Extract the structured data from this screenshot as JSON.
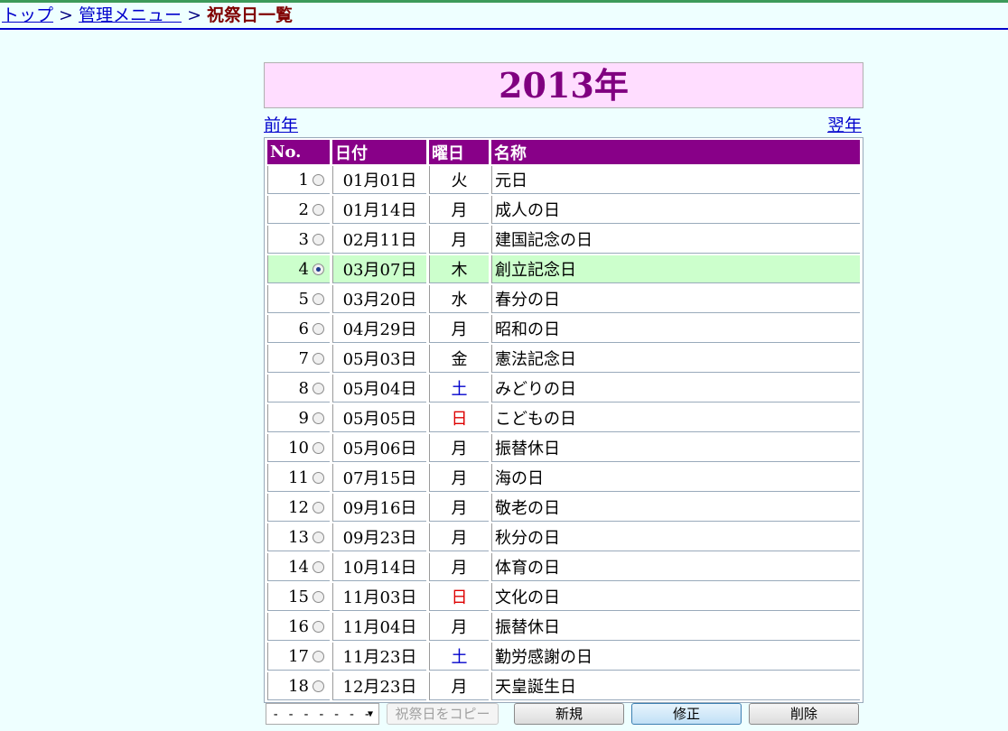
{
  "breadcrumb": {
    "top": "トップ",
    "sep1": " > ",
    "menu": "管理メニュー",
    "sep2": " > ",
    "current": "祝祭日一覧"
  },
  "year_title": "2013年",
  "nav": {
    "prev": "前年",
    "next": "翌年"
  },
  "table": {
    "headers": {
      "no": "No.",
      "date": "日付",
      "dow": "曜日",
      "name": "名称"
    },
    "rows": [
      {
        "no": "1",
        "date": "01月01日",
        "dow": "火",
        "name": "元日",
        "dow_type": "weekday",
        "selected": false
      },
      {
        "no": "2",
        "date": "01月14日",
        "dow": "月",
        "name": "成人の日",
        "dow_type": "weekday",
        "selected": false
      },
      {
        "no": "3",
        "date": "02月11日",
        "dow": "月",
        "name": "建国記念の日",
        "dow_type": "weekday",
        "selected": false
      },
      {
        "no": "4",
        "date": "03月07日",
        "dow": "木",
        "name": "創立記念日",
        "dow_type": "weekday",
        "selected": true
      },
      {
        "no": "5",
        "date": "03月20日",
        "dow": "水",
        "name": "春分の日",
        "dow_type": "weekday",
        "selected": false
      },
      {
        "no": "6",
        "date": "04月29日",
        "dow": "月",
        "name": "昭和の日",
        "dow_type": "weekday",
        "selected": false
      },
      {
        "no": "7",
        "date": "05月03日",
        "dow": "金",
        "name": "憲法記念日",
        "dow_type": "weekday",
        "selected": false
      },
      {
        "no": "8",
        "date": "05月04日",
        "dow": "土",
        "name": "みどりの日",
        "dow_type": "sat",
        "selected": false
      },
      {
        "no": "9",
        "date": "05月05日",
        "dow": "日",
        "name": "こどもの日",
        "dow_type": "sun",
        "selected": false
      },
      {
        "no": "10",
        "date": "05月06日",
        "dow": "月",
        "name": "振替休日",
        "dow_type": "weekday",
        "selected": false
      },
      {
        "no": "11",
        "date": "07月15日",
        "dow": "月",
        "name": "海の日",
        "dow_type": "weekday",
        "selected": false
      },
      {
        "no": "12",
        "date": "09月16日",
        "dow": "月",
        "name": "敬老の日",
        "dow_type": "weekday",
        "selected": false
      },
      {
        "no": "13",
        "date": "09月23日",
        "dow": "月",
        "name": "秋分の日",
        "dow_type": "weekday",
        "selected": false
      },
      {
        "no": "14",
        "date": "10月14日",
        "dow": "月",
        "name": "体育の日",
        "dow_type": "weekday",
        "selected": false
      },
      {
        "no": "15",
        "date": "11月03日",
        "dow": "日",
        "name": "文化の日",
        "dow_type": "sun",
        "selected": false
      },
      {
        "no": "16",
        "date": "11月04日",
        "dow": "月",
        "name": "振替休日",
        "dow_type": "weekday",
        "selected": false
      },
      {
        "no": "17",
        "date": "11月23日",
        "dow": "土",
        "name": "勤労感謝の日",
        "dow_type": "sat",
        "selected": false
      },
      {
        "no": "18",
        "date": "12月23日",
        "dow": "月",
        "name": "天皇誕生日",
        "dow_type": "weekday",
        "selected": false
      }
    ]
  },
  "actions": {
    "select_value": "- - - - - - -",
    "copy": "祝祭日をコピー",
    "new": "新規",
    "edit": "修正",
    "delete": "削除"
  },
  "colors": {
    "background": "#eeffff",
    "header_bg": "#880088",
    "title_bg": "#ffddff",
    "selected_row": "#ccffcc",
    "saturday": "#0000cc",
    "sunday": "#dd0000"
  }
}
